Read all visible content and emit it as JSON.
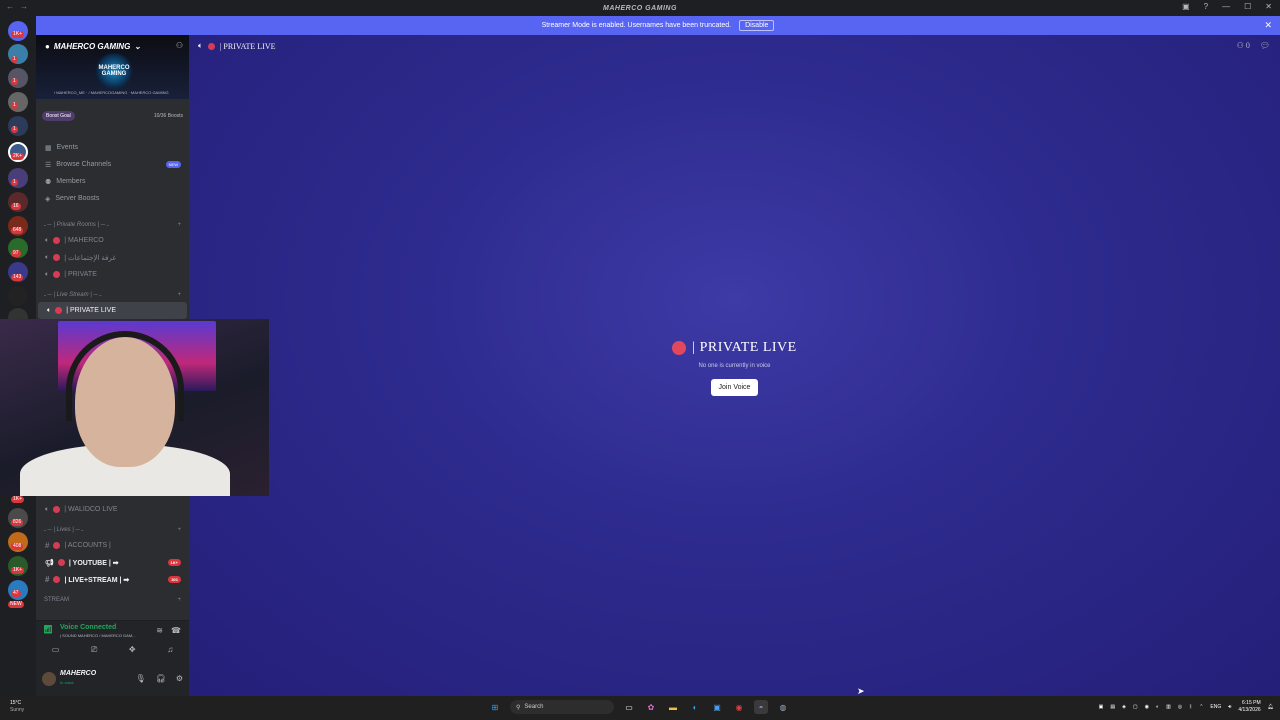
{
  "window": {
    "title": "MAHERCO GAMING"
  },
  "guilds": {
    "badges": [
      "1K+",
      "1",
      "1",
      "1",
      "1",
      "2K+",
      "1",
      "16",
      "648",
      "97",
      "143",
      "1K+",
      "3",
      "1",
      "826",
      "408",
      "1K+",
      "47"
    ],
    "new_label": "NEW"
  },
  "banner": {
    "message": "Streamer Mode is enabled. Usernames have been truncated.",
    "disable": "Disable"
  },
  "server": {
    "name": "MAHERCO GAMING",
    "logo_text": "MAHERCO GAMING",
    "sub_text": "/ MAHERCO_ME · / MAHERCOGAMING · MAHERCO GAMING",
    "boost_goal": "Boost Goal",
    "boost_progress": "10/36 Boosts"
  },
  "nav": {
    "events": "Events",
    "browse": "Browse Channels",
    "browse_badge": "NEW",
    "members": "Members",
    "boosts": "Server Boosts"
  },
  "categories": {
    "private": "ـ ─ | Private Rooms | ─ ـ",
    "live": "ـ ─ | Live Stream | ─ ـ",
    "lives": "ـ ─ | Lives | ─ ـ",
    "stream": "STREAM"
  },
  "channels": {
    "private": [
      "| MAHERCO",
      "| غرفة الإجتماعات",
      "| PRIVATE"
    ],
    "live_active": "| PRIVATE LIVE",
    "walidco": "| WALIDCO LIVE",
    "accounts": "| ACCOUNTS |",
    "youtube": "| YOUTUBE | ➡",
    "youtube_count": "1K+",
    "livestream": "| LIVE+STREAM | ➡",
    "livestream_count": "301"
  },
  "voice": {
    "status": "Voice Connected",
    "sub": "| SOUND MAHERCO / MAHERCO GAM..."
  },
  "user": {
    "name": "MAHERCO",
    "status": "In voice"
  },
  "header": {
    "channel": "| PRIVATE LIVE",
    "member_count": "0"
  },
  "stage": {
    "title": "| PRIVATE LIVE",
    "subtitle": "No one is currently in voice",
    "join": "Join Voice"
  },
  "taskbar": {
    "temp": "15°C",
    "weather": "Sunny",
    "search": "Search",
    "lang": "ENG",
    "time": "6:15 PM",
    "date": "4/13/2026"
  },
  "colors": {
    "accent": "#5865f2",
    "live_dot": "#d83c55",
    "voice_green": "#23a55a"
  }
}
